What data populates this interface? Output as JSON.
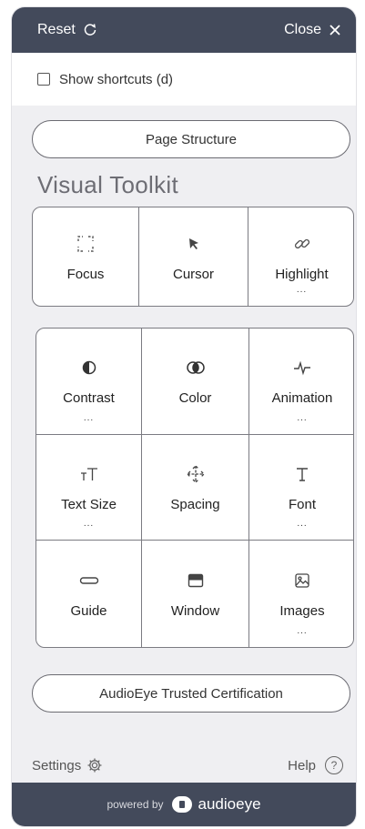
{
  "header": {
    "reset_label": "Reset",
    "close_label": "Close"
  },
  "shortcuts": {
    "label": "Show shortcuts (d)",
    "checked": false
  },
  "page_structure_label": "Page Structure",
  "toolkit_title": "Visual Toolkit",
  "tools_row": [
    {
      "label": "Focus",
      "icon": "focus-icon",
      "has_more": false
    },
    {
      "label": "Cursor",
      "icon": "cursor-icon",
      "has_more": false
    },
    {
      "label": "Highlight",
      "icon": "link-icon",
      "has_more": true
    }
  ],
  "tools_grid": [
    {
      "label": "Contrast",
      "icon": "contrast-icon",
      "has_more": true
    },
    {
      "label": "Color",
      "icon": "color-icon",
      "has_more": false
    },
    {
      "label": "Animation",
      "icon": "animation-icon",
      "has_more": true
    },
    {
      "label": "Text Size",
      "icon": "text-size-icon",
      "has_more": true
    },
    {
      "label": "Spacing",
      "icon": "spacing-icon",
      "has_more": false
    },
    {
      "label": "Font",
      "icon": "font-icon",
      "has_more": true
    },
    {
      "label": "Guide",
      "icon": "guide-icon",
      "has_more": false
    },
    {
      "label": "Window",
      "icon": "window-icon",
      "has_more": false
    },
    {
      "label": "Images",
      "icon": "images-icon",
      "has_more": true
    }
  ],
  "more_dots": "...",
  "certification_label": "AudioEye Trusted Certification",
  "footer": {
    "settings_label": "Settings",
    "help_label": "Help",
    "help_glyph": "?"
  },
  "branding": {
    "powered_by": "powered by",
    "brand": "audioeye"
  }
}
